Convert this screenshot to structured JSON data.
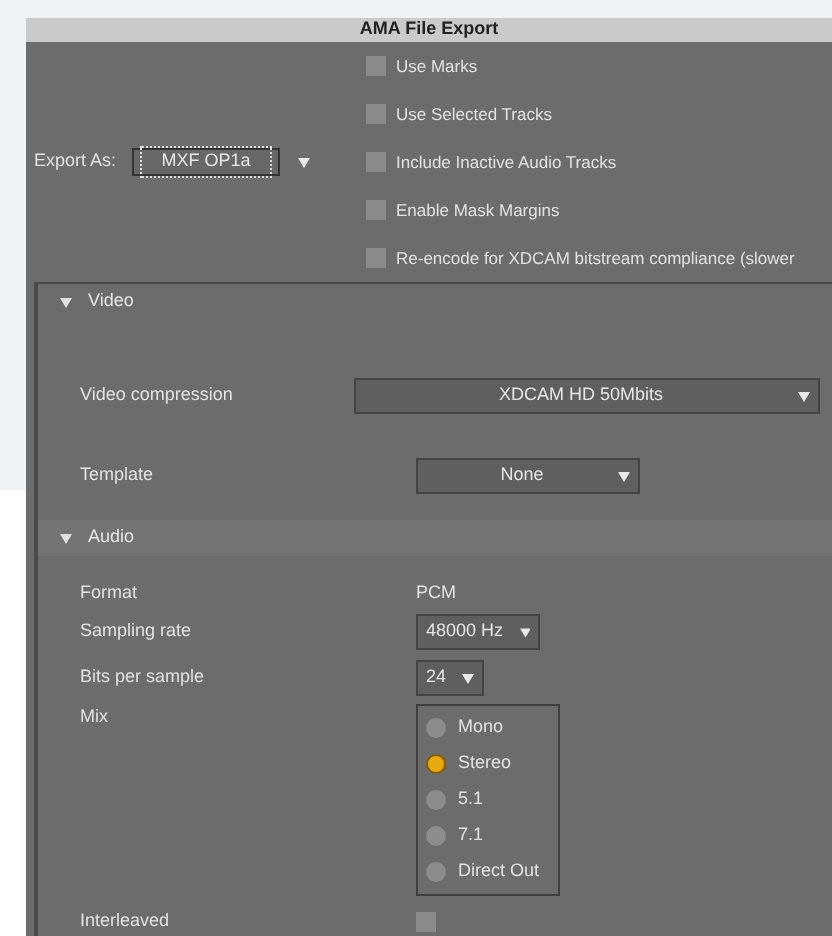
{
  "window": {
    "title": "AMA File Export"
  },
  "export_as": {
    "label": "Export As:",
    "value": "MXF OP1a"
  },
  "options": [
    {
      "label": "Use Marks",
      "checked": false
    },
    {
      "label": "Use Selected Tracks",
      "checked": false
    },
    {
      "label": "Include Inactive Audio Tracks",
      "checked": false
    },
    {
      "label": "Enable Mask Margins",
      "checked": false
    },
    {
      "label": "Re-encode for XDCAM bitstream compliance (slower",
      "checked": false
    }
  ],
  "video": {
    "header": "Video",
    "expanded": true,
    "compression": {
      "label": "Video compression",
      "value": "XDCAM HD 50Mbits"
    },
    "template": {
      "label": "Template",
      "value": "None"
    }
  },
  "audio": {
    "header": "Audio",
    "expanded": true,
    "format": {
      "label": "Format",
      "value": "PCM"
    },
    "sampling_rate": {
      "label": "Sampling rate",
      "value": "48000 Hz"
    },
    "bits_per_sample": {
      "label": "Bits per sample",
      "value": "24"
    },
    "mix": {
      "label": "Mix",
      "options": [
        {
          "label": "Mono",
          "selected": false
        },
        {
          "label": "Stereo",
          "selected": true
        },
        {
          "label": "5.1",
          "selected": false
        },
        {
          "label": "7.1",
          "selected": false
        },
        {
          "label": "Direct Out",
          "selected": false
        }
      ]
    },
    "interleaved": {
      "label": "Interleaved",
      "checked": false
    }
  }
}
